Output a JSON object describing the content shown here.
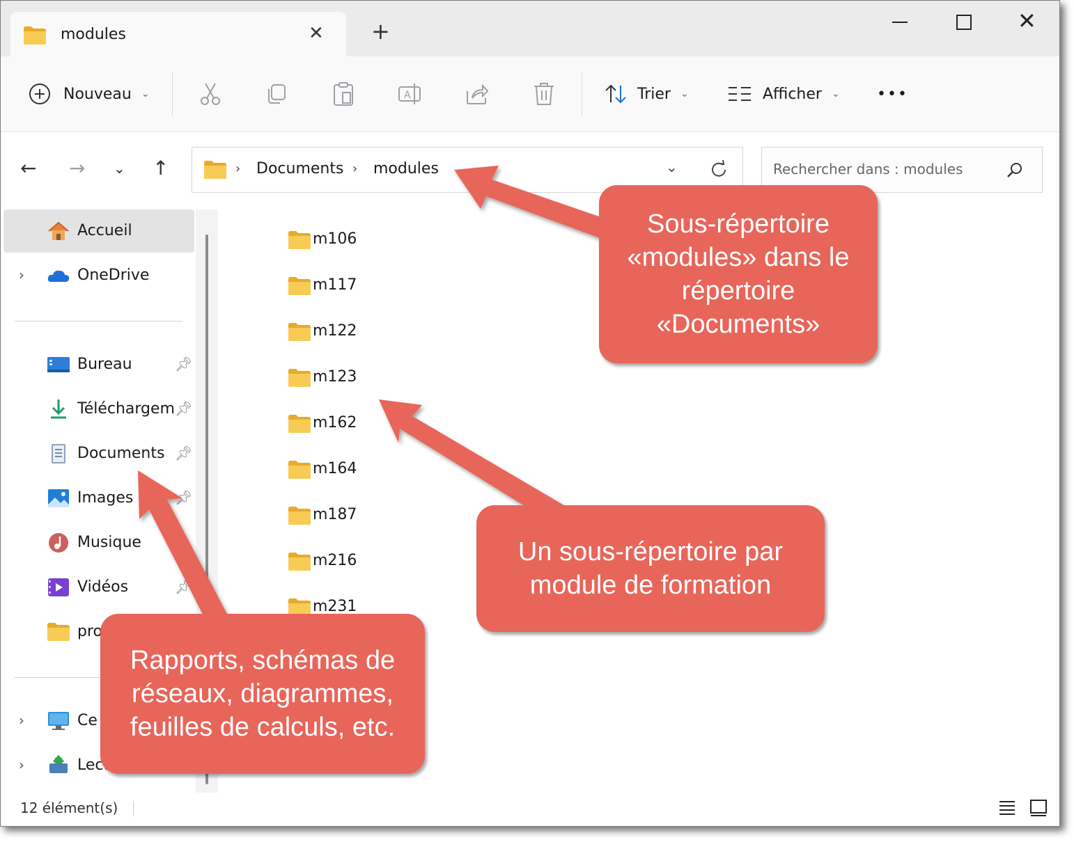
{
  "window": {
    "tab_title": "modules",
    "new_tab_symbol": "+"
  },
  "toolbar": {
    "new_label": "Nouveau",
    "sort_label": "Trier",
    "view_label": "Afficher",
    "more_label": "•••",
    "icons": [
      "cut-icon",
      "copy-icon",
      "paste-icon",
      "rename-icon",
      "share-icon",
      "delete-icon"
    ]
  },
  "address": {
    "crumbs": [
      "Documents",
      "modules"
    ],
    "separator": "›"
  },
  "search": {
    "placeholder": "Rechercher dans : modules"
  },
  "sidebar": {
    "items": [
      {
        "label": "Accueil"
      },
      {
        "label": "OneDrive"
      },
      {
        "label": "Bureau"
      },
      {
        "label": "Téléchargem"
      },
      {
        "label": "Documents"
      },
      {
        "label": "Images"
      },
      {
        "label": "Musique"
      },
      {
        "label": "Vidéos"
      },
      {
        "label": "proj"
      },
      {
        "label": "Ce"
      },
      {
        "label": "Lect"
      }
    ]
  },
  "content": {
    "folders": [
      "m106",
      "m117",
      "m122",
      "m123",
      "m162",
      "m164",
      "m187",
      "m216",
      "m231"
    ]
  },
  "statusbar": {
    "count": "12 élément(s)"
  },
  "callouts": {
    "top_right": "Sous-répertoire «modules» dans le répertoire «Documents»",
    "middle_right": "Un sous-répertoire par module de formation",
    "bottom_left": "Rapports, schémas de réseaux, diagrammes, feuilles de calculs, etc."
  },
  "colors": {
    "callout": "#e8655a",
    "folder": "#f6c34a",
    "selected": "#e3e3e3"
  }
}
